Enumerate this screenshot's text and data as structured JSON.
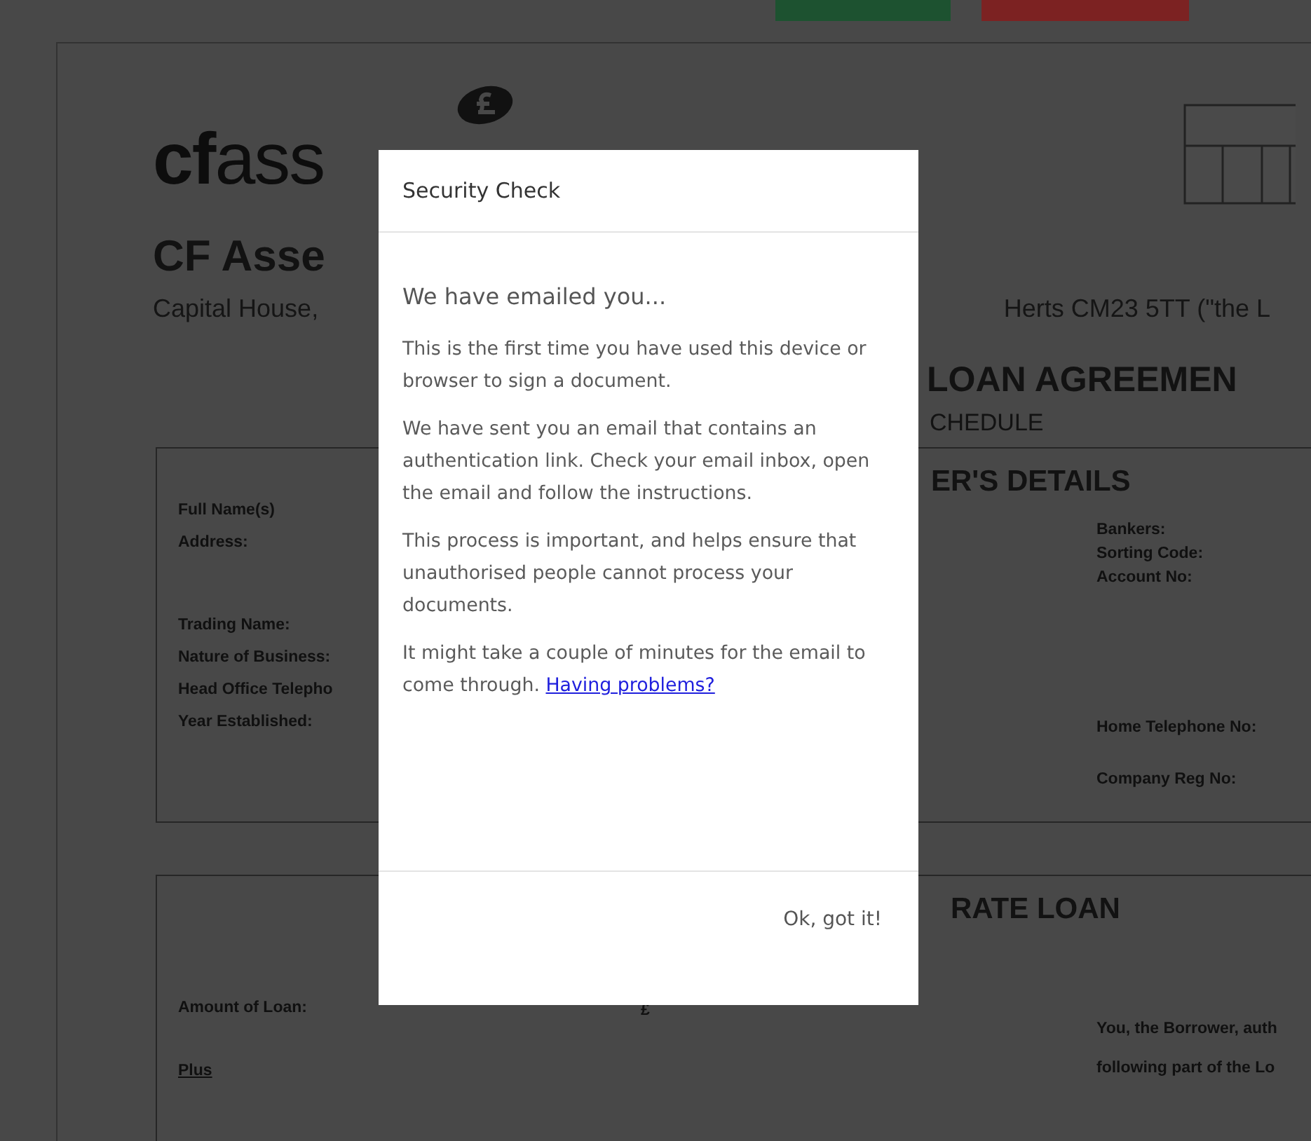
{
  "top_buttons": [
    {
      "color": "#1d5230"
    },
    {
      "color": "#7c2222"
    }
  ],
  "document": {
    "logo_text": "**cf**ass",
    "company_name": "CF Asse",
    "address_left": "Capital House,",
    "address_right": "Herts CM23 5TT (\"the L",
    "title": "LOAN AGREEMEN",
    "subtitle": "CHEDULE",
    "borrower_section": {
      "heading": "ER'S DETAILS",
      "left_groups": [
        [
          "Full Name(s)",
          "Address:"
        ],
        [
          "Trading Name:",
          "Nature of Business:",
          "Head Office Telepho",
          "Year Established:"
        ]
      ],
      "right_groups": [
        [
          "Bankers:",
          "Sorting Code:",
          "Account No:"
        ],
        [
          "Home Telephone No:",
          "Company Reg No:"
        ]
      ]
    },
    "loan_section": {
      "heading": "RATE LOAN",
      "amount_label": "Amount of Loan:",
      "currency": "£",
      "plus_label": "Plus",
      "right_lines": [
        "You, the Borrower, auth",
        "following part of the Lo"
      ]
    }
  },
  "dialog": {
    "title": "Security Check",
    "heading": "We have emailed you...",
    "paragraphs": [
      {
        "text": "This is the first time you have used this device or browser to sign a document."
      },
      {
        "text": "We have sent you an email that contains an authentication link. Check your email inbox, open the email and follow the instructions."
      },
      {
        "text": "This process is important, and helps ensure that unauthorised people cannot process your documents."
      },
      {
        "text": "It might take a couple of minutes for the email to come through.",
        "link": "Having problems?"
      }
    ],
    "button": "Ok, got it!"
  }
}
